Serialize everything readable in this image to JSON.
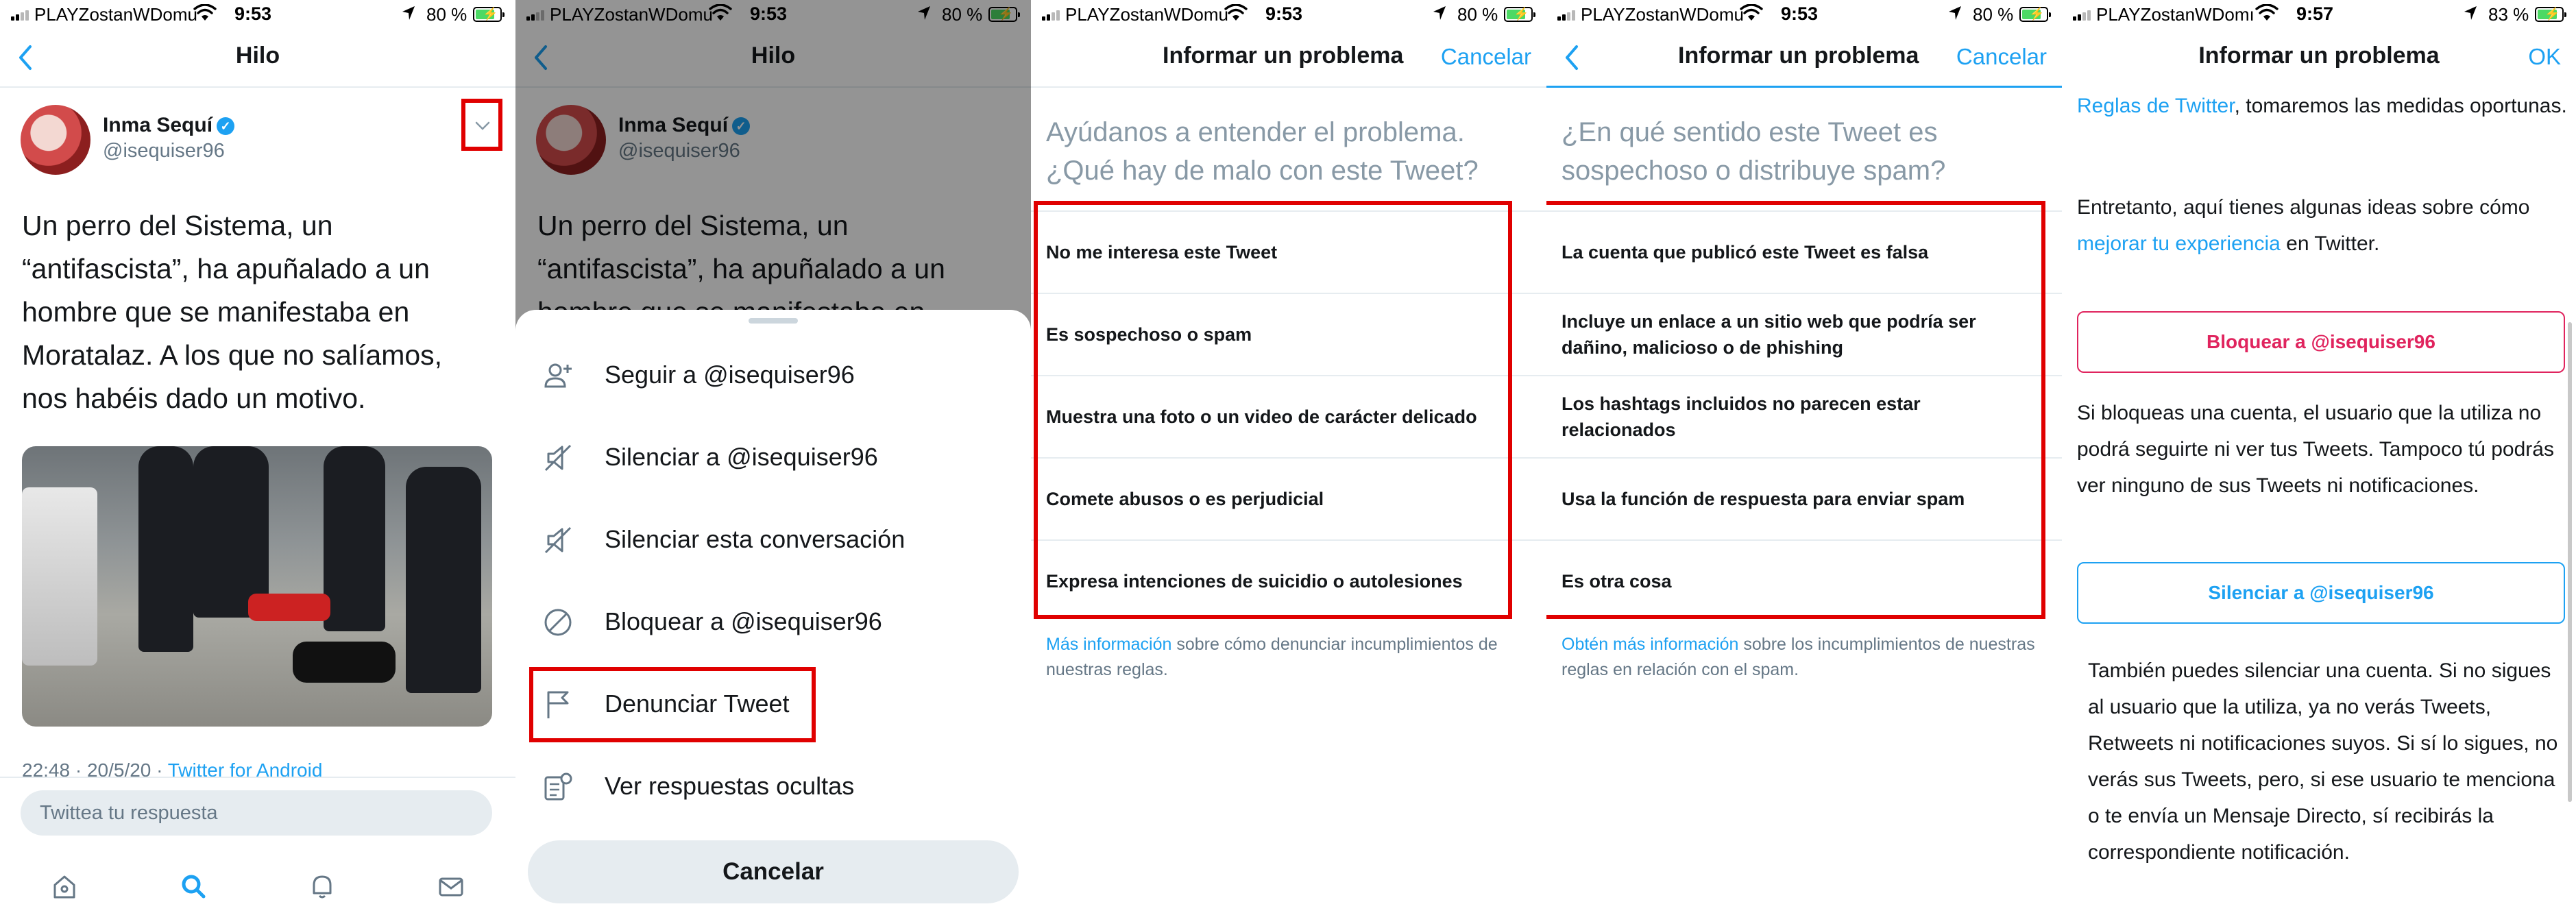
{
  "status": [
    {
      "carrier": "PLAYZostanWDomu",
      "time": "9:53",
      "battery": "80 %",
      "battery_level": 0.8,
      "charging": true
    },
    {
      "carrier": "PLAYZostanWDomu",
      "time": "9:53",
      "battery": "80 %",
      "battery_level": 0.8,
      "charging": true
    },
    {
      "carrier": "PLAYZostanWDomu",
      "time": "9:53",
      "battery": "80 %",
      "battery_level": 0.8,
      "charging": true
    },
    {
      "carrier": "PLAYZostanWDomu",
      "time": "9:53",
      "battery": "80 %",
      "battery_level": 0.8,
      "charging": true
    },
    {
      "carrier": "PLAYZostanWDomı",
      "time": "9:57",
      "battery": "83 %",
      "battery_level": 0.83,
      "charging": true
    }
  ],
  "thread": {
    "title": "Hilo",
    "user_name": "Inma Sequí",
    "user_handle": "@isequiser96",
    "tweet_text": "Un perro del Sistema, un “antifascista”, ha apuñalado a un hombre que se manifestaba en Moratalaz. A los que no salíamos, nos habéis dado un motivo.",
    "meta_time": "22:48 · 20/5/20 · ",
    "meta_source": "Twitter for Android",
    "reply_placeholder": "Twittea tu respuesta",
    "tabs": [
      "home-icon",
      "search-icon",
      "bell-icon",
      "mail-icon"
    ]
  },
  "menu": {
    "items": [
      {
        "icon": "follow-user-icon",
        "label": "Seguir a @isequiser96"
      },
      {
        "icon": "mute-icon",
        "label": "Silenciar a @isequiser96"
      },
      {
        "icon": "mute-conversation-icon",
        "label": "Silenciar esta conversación"
      },
      {
        "icon": "block-icon",
        "label": "Bloquear a @isequiser96"
      },
      {
        "icon": "flag-icon",
        "label": "Denunciar Tweet"
      },
      {
        "icon": "hidden-replies-icon",
        "label": "Ver respuestas ocultas"
      }
    ],
    "cancel": "Cancelar"
  },
  "report1": {
    "title": "Informar un problema",
    "cancel": "Cancelar",
    "question": "Ayúdanos a entender el problema. ¿Qué hay de malo con este Tweet?",
    "options": [
      "No me interesa este Tweet",
      "Es sospechoso o spam",
      "Muestra una foto o un video de carácter delicado",
      "Comete abusos o es perjudicial",
      "Expresa intenciones de suicidio o autolesiones"
    ],
    "footer_link": "Más información",
    "footer_text": " sobre cómo denunciar incumplimientos de nuestras reglas."
  },
  "report2": {
    "title": "Informar un problema",
    "cancel": "Cancelar",
    "question": "¿En qué sentido este Tweet es sospechoso o distribuye spam?",
    "options": [
      "La cuenta que publicó este Tweet es falsa",
      "Incluye un enlace a un sitio web que podría ser dañino, malicioso o de phishing",
      "Los hashtags incluidos no parecen estar relacionados",
      "Usa la función de respuesta para enviar spam",
      "Es otra cosa"
    ],
    "footer_link": "Obtén más información",
    "footer_text": " sobre los incumplimientos de nuestras reglas en relación con el spam."
  },
  "report3": {
    "title": "Informar un problema",
    "ok": "OK",
    "p1_link": "Reglas de Twitter",
    "p1_text": ", tomaremos las medidas oportunas.",
    "p2_text_a": "Entretanto, aquí tienes algunas ideas sobre cómo ",
    "p2_link": "mejorar tu experiencia",
    "p2_text_b": " en Twitter.",
    "block_button": "Bloquear a @isequiser96",
    "block_text": "Si bloqueas una cuenta, el usuario que la utiliza no podrá seguirte ni ver tus Tweets. Tampoco tú podrás ver ninguno de sus Tweets ni notificaciones.",
    "mute_button": "Silenciar a @isequiser96",
    "mute_text": "También puedes silenciar una cuenta. Si no sigues al usuario que la utiliza, ya no verás Tweets, Retweets ni notificaciones suyos. Si sí lo sigues, no verás sus Tweets, pero, si ese usuario te menciona o te envía un Mensaje Directo, sí recibirás la correspondiente notificación."
  },
  "colors": {
    "accent": "#1da1f2",
    "highlight": "#e00000",
    "block": "#e0245e",
    "text": "#14171a",
    "muted": "#657786"
  }
}
